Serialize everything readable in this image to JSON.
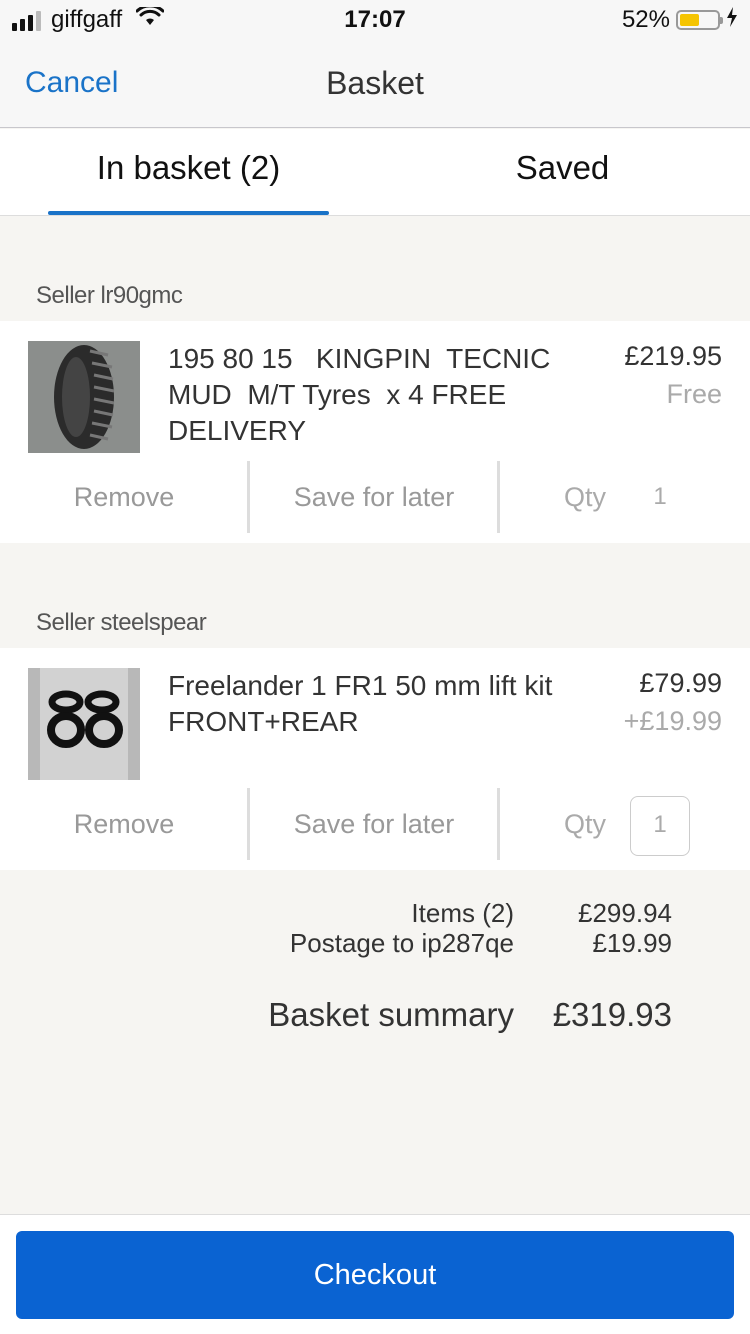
{
  "status_bar": {
    "carrier": "giffgaff",
    "time": "17:07",
    "battery_percent": "52%",
    "battery_level": 0.52,
    "icons": [
      "signal-icon",
      "wifi-icon",
      "battery-icon",
      "charging-icon"
    ]
  },
  "nav": {
    "cancel_label": "Cancel",
    "title": "Basket"
  },
  "tabs": [
    {
      "label": "In basket (2)",
      "active": true
    },
    {
      "label": "Saved",
      "active": false
    }
  ],
  "sellers": [
    {
      "label": "Seller lr90gmc",
      "item": {
        "title": "195 80 15   KINGPIN  TECNIC\nMUD  M/T Tyres  x 4 FREE\nDELIVERY",
        "price": "£219.95",
        "postage": "Free",
        "remove_label": "Remove",
        "save_label": "Save for later",
        "qty_label": "Qty",
        "qty_value": "1",
        "thumbnail": "tyre-image"
      }
    },
    {
      "label": "Seller steelspear",
      "item": {
        "title": "Freelander 1 FR1 50 mm lift kit\nFRONT+REAR",
        "price": "£79.99",
        "postage": "+£19.99",
        "remove_label": "Remove",
        "save_label": "Save for later",
        "qty_label": "Qty",
        "qty_value": "1",
        "thumbnail": "lift-kit-image"
      }
    }
  ],
  "summary": {
    "items_label": "Items (2)",
    "items_value": "£299.94",
    "postage_label": "Postage to ip287qe",
    "postage_value": "£19.99",
    "total_label": "Basket summary",
    "total_value": "£319.93"
  },
  "footer": {
    "checkout_label": "Checkout"
  },
  "colors": {
    "accent": "#1a73c8",
    "button": "#0a63d2",
    "background": "#f6f5f2",
    "battery": "#f5c400"
  }
}
